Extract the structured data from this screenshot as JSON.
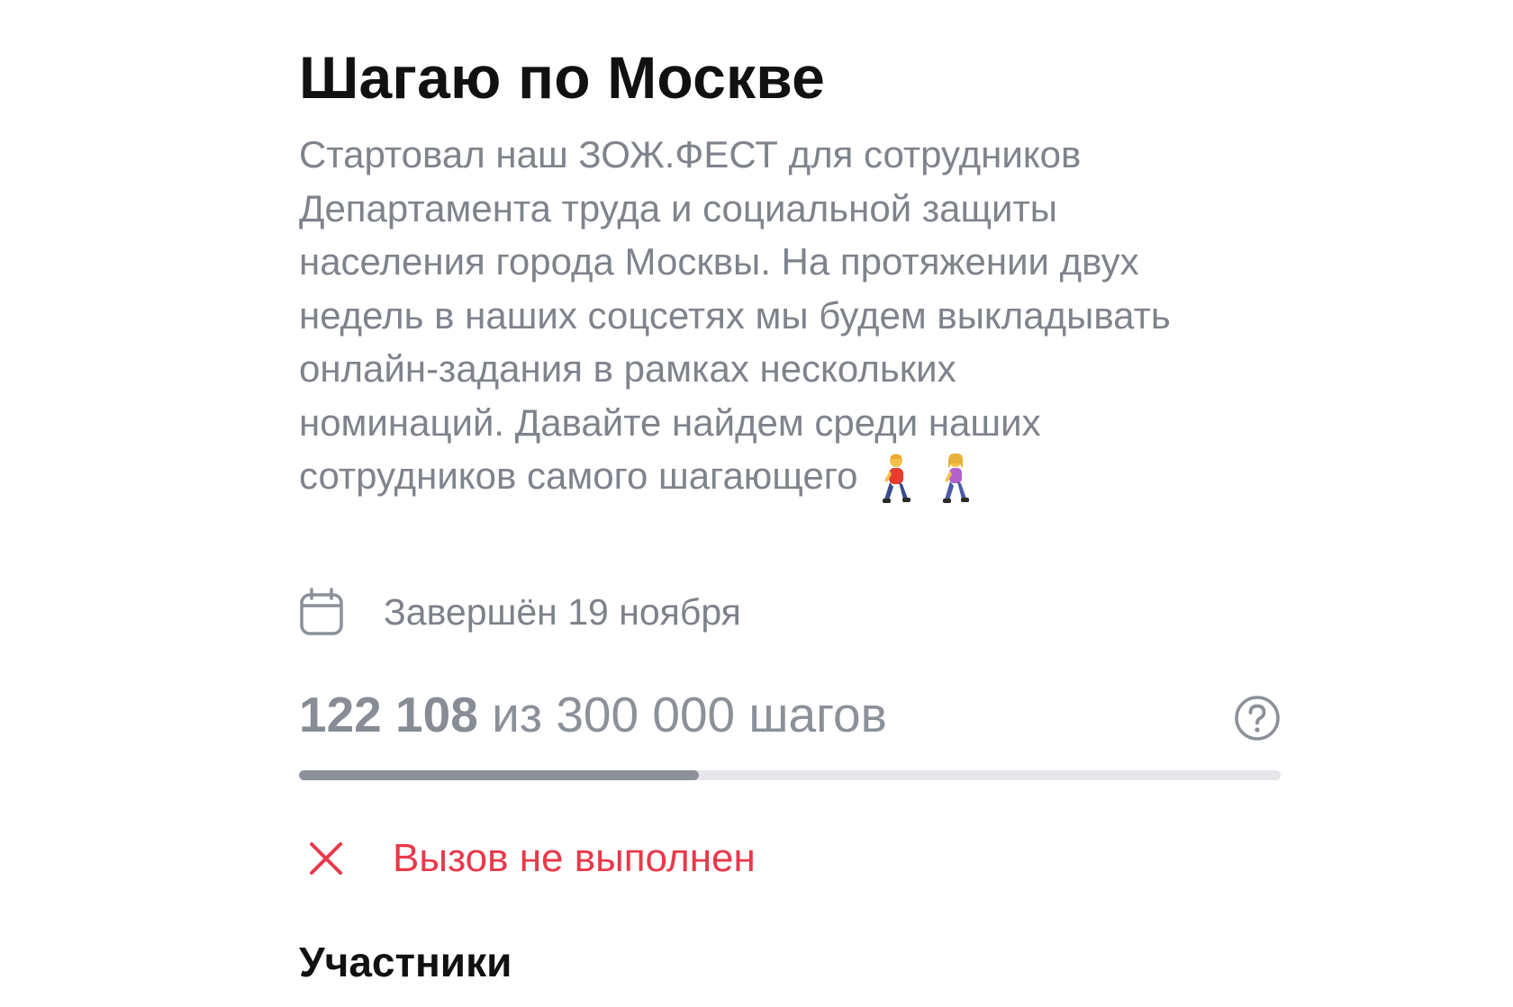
{
  "challenge": {
    "title": "Шагаю по Москве",
    "description_lines": [
      "Стартовал наш ЗОЖ.ФЕСТ для сотрудников",
      "Департамента труда и социальной защиты",
      "населения города Москвы. На протяжении двух",
      "недель в наших соцсетях мы будем выкладывать",
      "онлайн-задания в рамках нескольких",
      "номинаций. Давайте найдем среди наших",
      "сотрудников самого шагающего"
    ],
    "description_emojis": [
      "🚶",
      "🚶‍♀️"
    ],
    "date_icon": "calendar-icon",
    "date_text": "Завершён 19 ноября",
    "steps": {
      "current": "122 108",
      "separator": " из ",
      "goal": "300 000 шагов",
      "help_icon": "question-circle-icon",
      "progress": 0.407
    },
    "status": {
      "icon": "close-icon",
      "text": "Вызов не выполнен",
      "color": "#e8394b"
    }
  },
  "participants": {
    "heading": "Участники"
  }
}
